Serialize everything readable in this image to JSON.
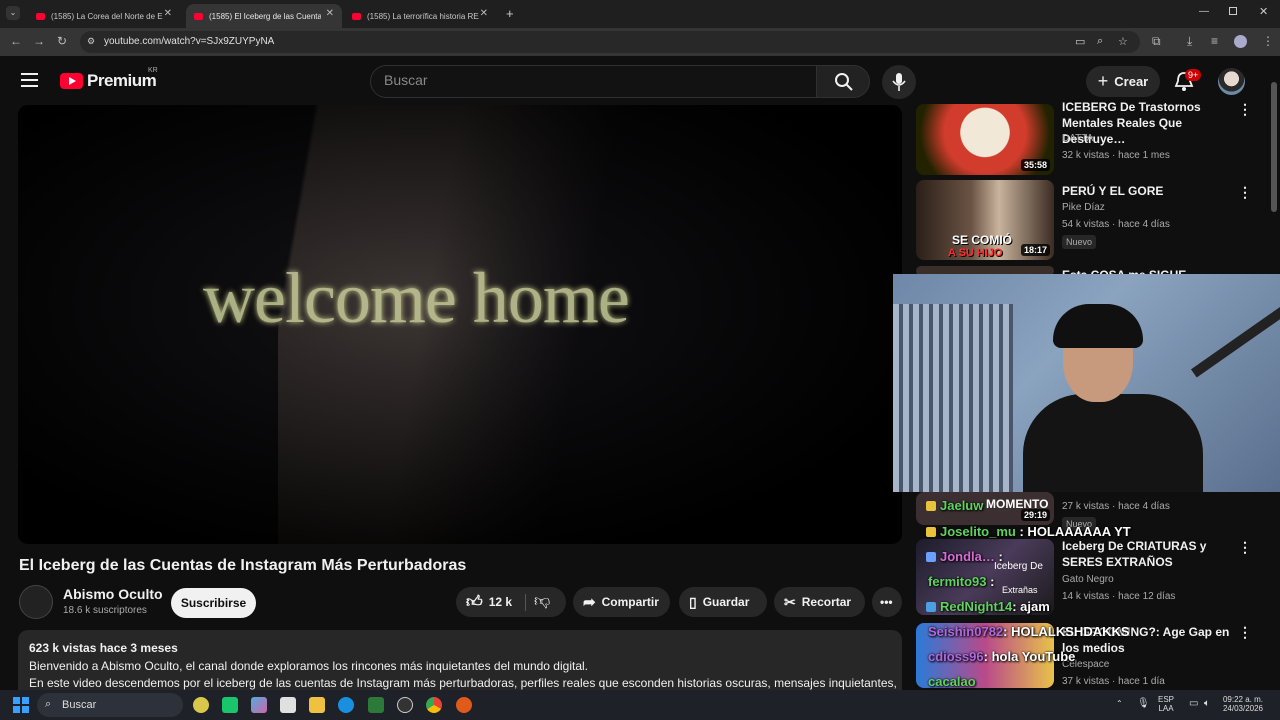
{
  "browser": {
    "tabs": [
      {
        "title": "(1585) La Corea del Norte de E…",
        "active": false
      },
      {
        "title": "(1585) El Iceberg de las Cuentas…",
        "active": true
      },
      {
        "title": "(1585) La terrorífica historia REAL…",
        "active": false
      }
    ],
    "new_tab": "+",
    "url": "youtube.com/watch?v=SJx9ZUYPyNA"
  },
  "header": {
    "logo_text": "Premium",
    "country_code": "KR",
    "search_placeholder": "Buscar",
    "create_label": "Crear",
    "notification_count": "9+"
  },
  "video": {
    "overlay_text": "welcome home",
    "title": "El Iceberg de las Cuentas de Instagram Más Perturbadoras",
    "channel": {
      "name": "Abismo Oculto",
      "subscribers": "18.6 k suscriptores"
    },
    "subscribe_label": "Suscribirse",
    "likes": "12 k",
    "share_label": "Compartir",
    "save_label": "Guardar",
    "clip_label": "Recortar",
    "description": {
      "meta": "623 k vistas  hace 3 meses",
      "line1": "Bienvenido a Abismo Oculto, el canal donde exploramos los rincones más inquietantes del mundo digital.",
      "line2": "En este video descendemos por el iceberg de las cuentas de Instagram más perturbadoras, perfiles reales que esconden historias oscuras, mensajes inquietantes,"
    }
  },
  "sidebar": {
    "videos": [
      {
        "title": "ICEBERG De Trastornos Mentales Reales Que Destruye…",
        "channel": "DATTA",
        "meta": "32 k vistas · hace 1 mes",
        "duration": "35:58"
      },
      {
        "title": "PERÚ Y EL GORE",
        "channel": "Pike Díaz",
        "meta": "54 k vistas · hace 4 días",
        "duration": "18:17",
        "badge": "Nuevo",
        "thumb_text_1": "SE COMIÓ",
        "thumb_text_2": "A SU HIJO"
      },
      {
        "title": "Esta COSA me SIGUE DONDE…"
      },
      {
        "meta": "27 k vistas · hace 4 días",
        "duration": "29:19",
        "badge": "Nuevo",
        "thumb_text_1": "MOMENTO"
      },
      {
        "title": "Iceberg De CRIATURAS y SERES EXTRAÑOS",
        "channel": "Gato Negro",
        "meta": "14 k vistas · hace 12 días",
        "thumb_text_1": "Iceberg De",
        "thumb_text_2": "Extrañas"
      },
      {
        "title": "EL GROOMING?: Age Gap en los medios",
        "channel": "Celespace",
        "meta": "37 k vistas · hace 1 día"
      }
    ]
  },
  "chat": [
    {
      "user": "Jaeluw",
      "message": ""
    },
    {
      "user": "Joselito_mu",
      "message": ": HOLAAAAAA YT"
    },
    {
      "user": "Jondla…",
      "message": ":"
    },
    {
      "user": "fermito93",
      "message": ":"
    },
    {
      "user": "RedNight14",
      "message": ": ajam"
    },
    {
      "user": "Seishin0782",
      "message": ": HOLALKSHDAKKS"
    },
    {
      "user": "cdioss96",
      "message": ": hola YouTube"
    },
    {
      "user": "cacalao",
      "message": ""
    }
  ],
  "taskbar": {
    "search_label": "Buscar",
    "lang_top": "ESP",
    "lang_bottom": "LAA",
    "time": "09:22 a. m.",
    "date": "24/03/2026"
  },
  "colors": {
    "youtube_red": "#ff0033",
    "chat_user": "#5fd35f",
    "background": "#0f0f0f"
  }
}
